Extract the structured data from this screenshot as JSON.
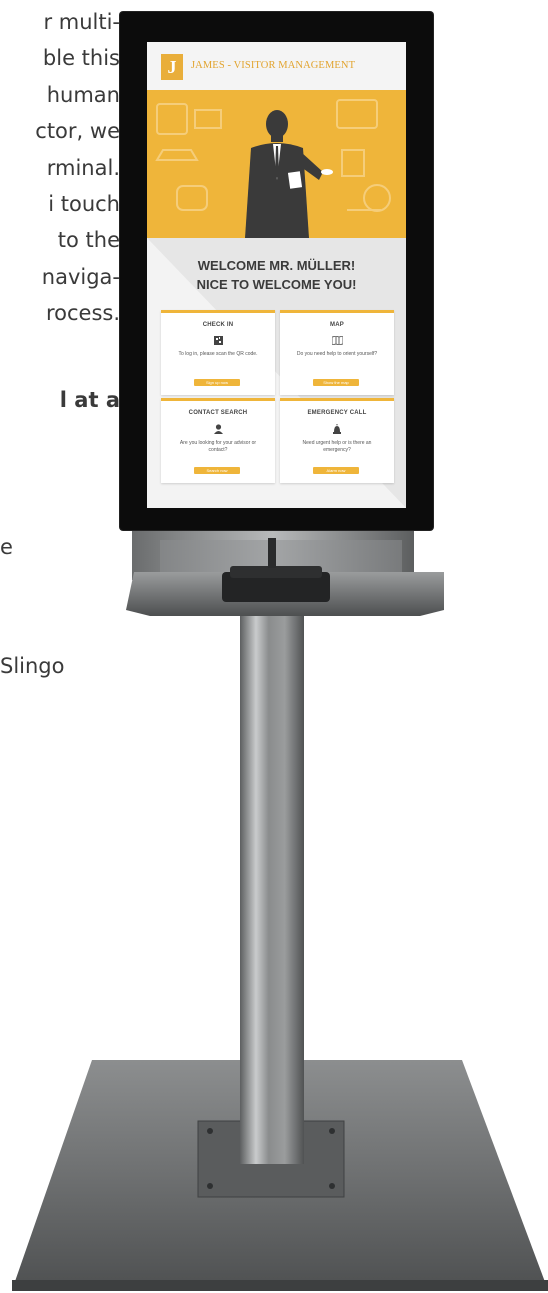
{
  "left_text": [
    "r multi-",
    "ble this",
    "human",
    "ctor, we",
    "rminal.",
    "i touch",
    "to the",
    "naviga-",
    "rocess.",
    "l at a",
    "e",
    "Slingo"
  ],
  "kiosk": {
    "header": {
      "logo_letter": "J",
      "title": "JAMES - VISITOR MANAGEMENT"
    },
    "welcome": {
      "line1": "WELCOME MR. MÜLLER!",
      "line2": "NICE TO WELCOME YOU!"
    },
    "cards": [
      {
        "title": "CHECK IN",
        "icon": "qr-code-icon",
        "desc": "To log in, please scan the QR code.",
        "button": "Sign up now"
      },
      {
        "title": "MAP",
        "icon": "map-icon",
        "desc": "Do you need help to orient yourself?",
        "button": "Show the map"
      },
      {
        "title": "CONTACT SEARCH",
        "icon": "person-icon",
        "desc": "Are you looking for your advisor or contact?",
        "button": "Search now"
      },
      {
        "title": "EMERGENCY CALL",
        "icon": "alarm-bell-icon",
        "desc": "Need urgent help or is there an emergency?",
        "button": "Alarm now"
      }
    ],
    "accent_color": "#efb53a"
  }
}
